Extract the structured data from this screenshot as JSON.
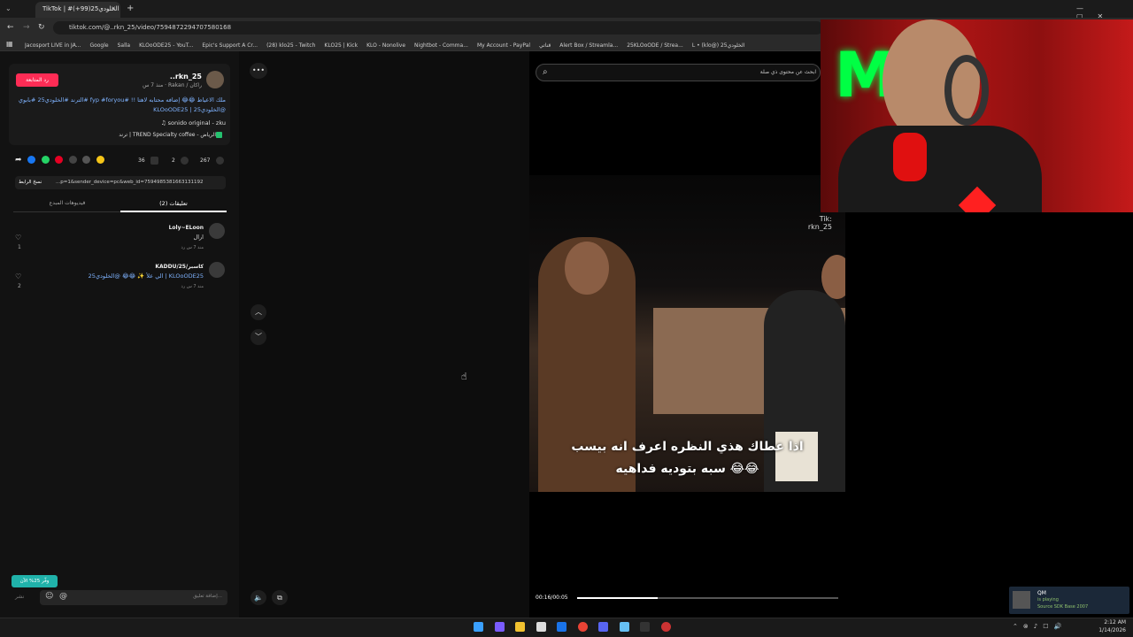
{
  "browser": {
    "tab_title": "TikTok | #الخلودي25(99+) 🔊",
    "url": "tiktok.com/@..rkn_25/video/759487229470758016​8",
    "bookmarks": [
      "Jacosport LIVE in JA...",
      "Google",
      "Salla",
      "KLOoODE25 - YouT...",
      "Epic's Support A Cr...",
      "(28) klo25 - Twitch",
      "KLO25 | Kick",
      "KLO - Nonolive",
      "Nightbot - Comma...",
      "My Account - PayPal",
      "قناتي",
      "Alert Box / Streamla...",
      "25KLOoODE / Strea...",
      "L • (klo@) الخلودي25"
    ]
  },
  "post": {
    "follow_label": "رد المتابعة",
    "username": "rkn_25..",
    "meta": "راكان / Rakan · منذ 7 س",
    "caption_line1": "ملك الاعياط 😂😂 إضافه محتابه لاهتا !! #fyp #foryou #الترند #الخلودي25 #بابوي",
    "caption_line2": "@الخلودي25 | KLOoODE25",
    "sound": "sonido original - zku ♫",
    "location": "الرياض - TREND Specialty coffee | ترند",
    "likes": "267",
    "comments": "2",
    "saves": "36",
    "link": "...p=1&sender_device=pc&web_id=7594985381663131192",
    "copy_link": "نسخ الرابط"
  },
  "tabs": {
    "comments": "تعليقات (2)",
    "creator_videos": "فيديوهات المبدع"
  },
  "comments": [
    {
      "user": "Loly~ELoon",
      "text": "ارال",
      "meta": "منذ 7 س   رد",
      "likes": "1"
    },
    {
      "user": "KADDU/25/كاسبر",
      "text": "الي علأ ✨ 😂😂 @الخلودي25 | KLOoODE25",
      "meta": "منذ 7 س   رد",
      "likes": "2"
    }
  ],
  "composer": {
    "placeholder": "إضافة تعليق...",
    "badge": "وفّر 25% الآن",
    "post_label": "نشر"
  },
  "video": {
    "search_placeholder": "ابحث عن محتوى ذي صلة",
    "subtitle1": "اذا عطاك هذي النظره اعرف انه بيسب",
    "subtitle2": "سبه بتوديه فداهيه 😂😂",
    "watermark": "Tik:\nrkn_25",
    "time": "00:16/00:05",
    "progress": 0.31
  },
  "steam": {
    "name": "QM",
    "status": "is playing",
    "game": "Source SDK Base 2007"
  },
  "clock": {
    "time": "2:12 AM",
    "date": "1/14/2026"
  },
  "colors": {
    "accent": "#fe2c55",
    "link": "#7fb3ff"
  }
}
